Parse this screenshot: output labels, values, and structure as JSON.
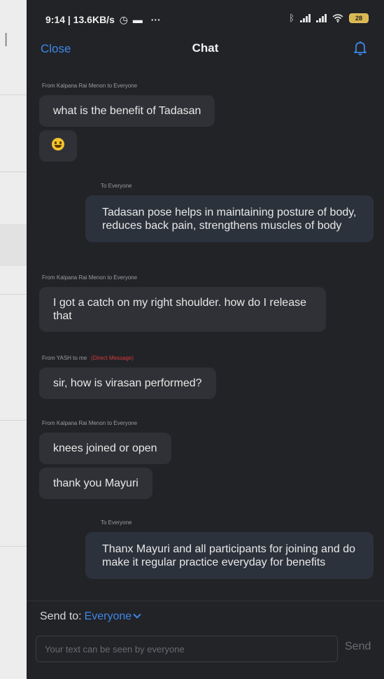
{
  "status_bar": {
    "time": "9:14 | 13.6KB/s",
    "dots": "···",
    "battery": "28"
  },
  "header": {
    "close_label": "Close",
    "title": "Chat"
  },
  "messages": [
    {
      "meta": "From Kalpana Rai Menon to Everyone",
      "text": "what is the benefit of Tadasan"
    },
    {
      "meta": "",
      "text": ""
    },
    {
      "meta": "To Everyone",
      "text": "Tadasan pose helps in maintaining posture of body, reduces back pain, strengthens muscles of body"
    },
    {
      "meta": "From Kalpana Rai Menon to Everyone",
      "text": "I got a catch on my right shoulder. how do I release that"
    },
    {
      "meta": "From YASH to me",
      "dm": "(Direct Message)",
      "text": "sir, how is virasan performed?"
    },
    {
      "meta": "From Kalpana Rai Menon to Everyone",
      "text": "knees joined or open"
    },
    {
      "meta": "",
      "text": "thank you Mayuri"
    },
    {
      "meta": "To Everyone",
      "text": "Thanx Mayuri and all participants for joining and do make it regular practice everyday for benefits"
    }
  ],
  "composer": {
    "send_to_label": "Send to:",
    "send_to_value": "Everyone",
    "placeholder": "Your text can be seen by everyone",
    "send_label": "Send"
  },
  "colors": {
    "accent": "#3d87e6",
    "background": "#222327",
    "bubble": "#303136",
    "bubble_mine": "#2c323c",
    "direct_message": "#d23a3a"
  }
}
